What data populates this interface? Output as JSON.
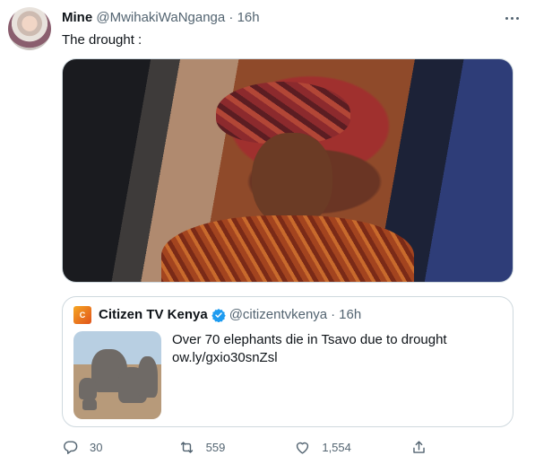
{
  "tweet": {
    "name": "Mine",
    "handle": "@MwihakiWaNganga",
    "separator": "·",
    "time": "16h",
    "text": "The drought :"
  },
  "quoted": {
    "name": "Citizen TV Kenya",
    "handle": "@citizentvkenya",
    "separator": "·",
    "time": "16h",
    "text_line1": "Over 70 elephants die in Tsavo due to drought",
    "text_line2": "ow.ly/gxio30snZsl",
    "verified_color": "#1d9bf0"
  },
  "actions": {
    "replies": "30",
    "retweets": "559",
    "likes": "1,554"
  },
  "colors": {
    "text": "#0f1419",
    "secondary": "#536471",
    "border": "#cfd9de"
  }
}
